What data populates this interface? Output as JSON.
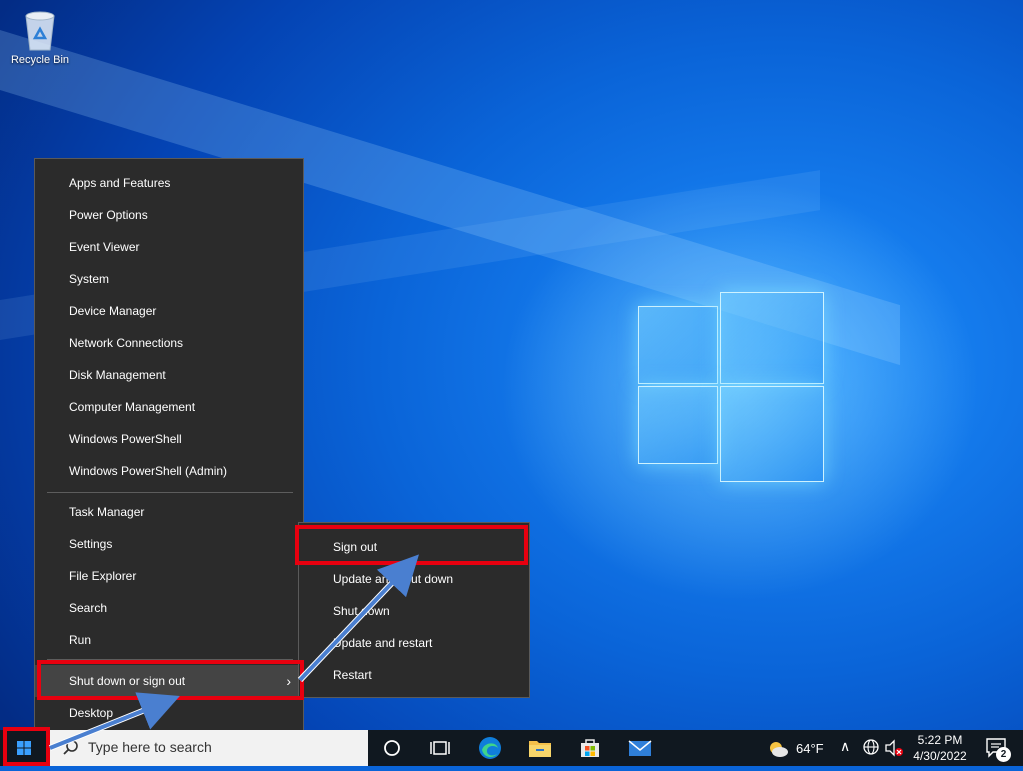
{
  "desktop": {
    "recycle_bin_label": "Recycle Bin"
  },
  "context_menu": {
    "group1": [
      "Apps and Features",
      "Power Options",
      "Event Viewer",
      "System",
      "Device Manager",
      "Network Connections",
      "Disk Management",
      "Computer Management",
      "Windows PowerShell",
      "Windows PowerShell (Admin)"
    ],
    "group2": [
      "Task Manager",
      "Settings",
      "File Explorer",
      "Search",
      "Run"
    ],
    "shutdown_label": "Shut down or sign out",
    "desktop_label": "Desktop"
  },
  "submenu": {
    "items": [
      "Sign out",
      "Update and shut down",
      "Shut down",
      "Update and restart",
      "Restart"
    ]
  },
  "taskbar": {
    "search_placeholder": "Type here to search",
    "weather_temp": "64°F",
    "time": "5:22 PM",
    "date": "4/30/2022",
    "notification_count": "2",
    "pinned_icons": [
      "cortana-icon",
      "task-view-icon",
      "edge-icon",
      "file-explorer-icon",
      "store-icon",
      "mail-icon"
    ]
  },
  "colors": {
    "highlight": "#e8000f",
    "menu_bg": "#2b2b2b",
    "annotation_arrow": "#4a7fd0"
  }
}
